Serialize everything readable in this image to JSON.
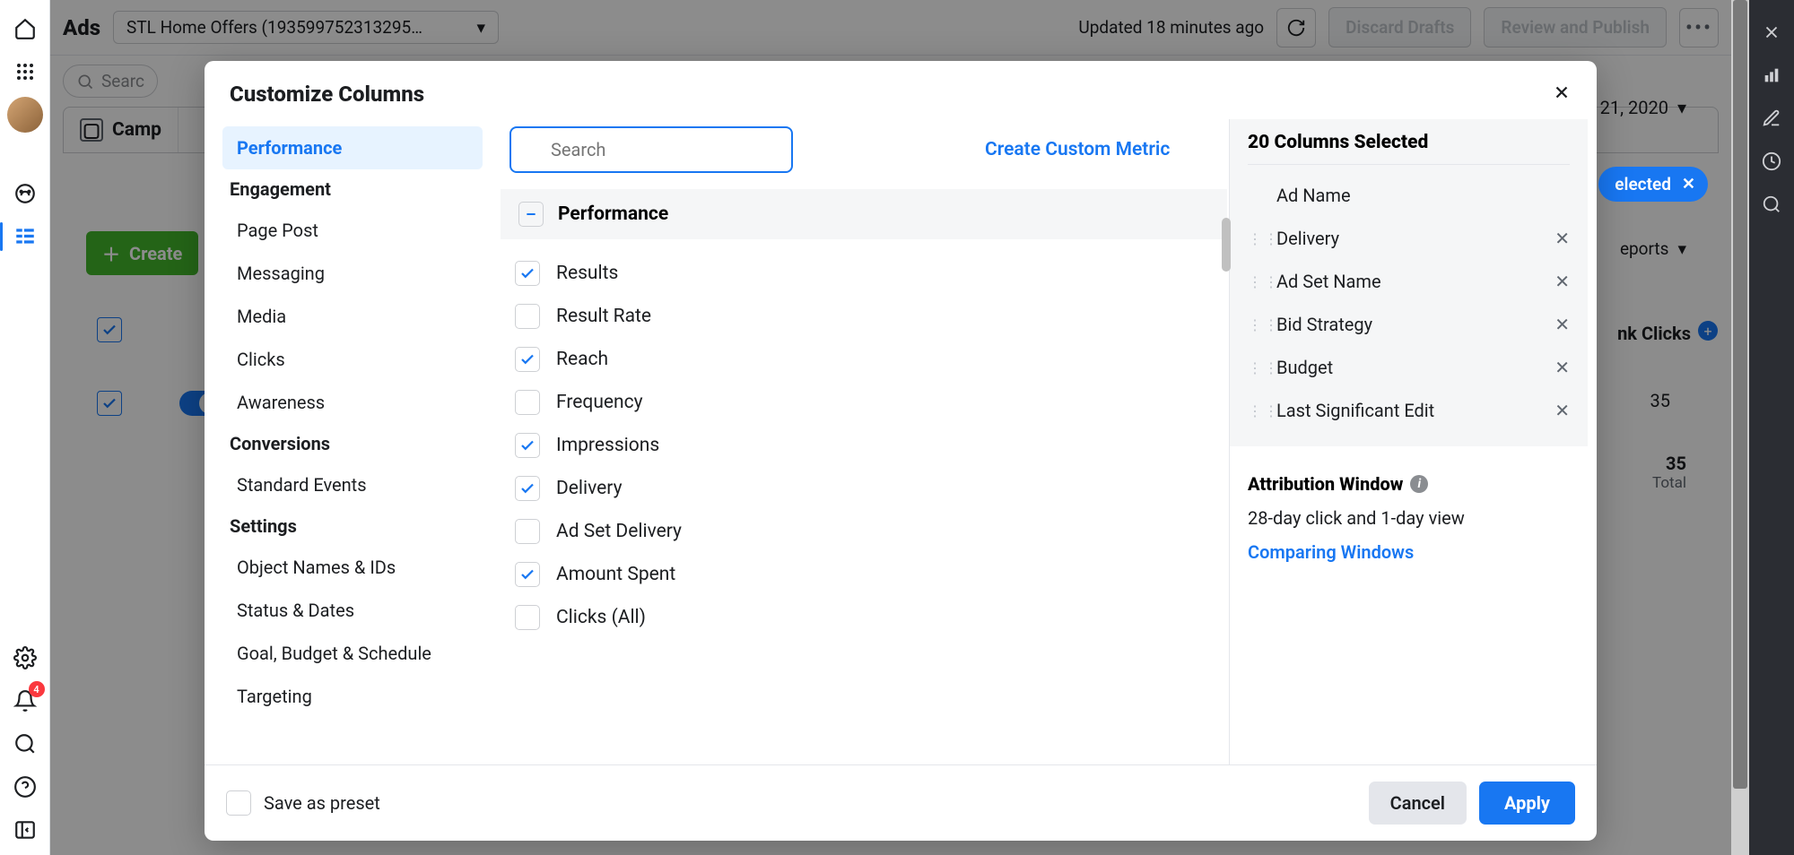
{
  "header": {
    "page_title": "Ads",
    "account_dropdown": "STL Home Offers (193599752313295…",
    "updated_text": "Updated 18 minutes ago",
    "discard_btn": "Discard Drafts",
    "publish_btn": "Review and Publish"
  },
  "search_placeholder": "Searc",
  "date_label": "21, 2020",
  "tabs": {
    "campaigns": "Camp"
  },
  "selected_pill": "elected",
  "reports_label": "eports",
  "bell_badge": "4",
  "table": {
    "col_link_clicks": "nk Clicks",
    "val_35": "35",
    "total_35": "35",
    "total_label": "Total"
  },
  "create_btn": "Create",
  "modal": {
    "title": "Customize Columns",
    "search_placeholder": "Search",
    "create_metric": "Create Custom Metric",
    "categories": [
      {
        "label": "Performance",
        "type": "item",
        "active": true
      },
      {
        "label": "Engagement",
        "type": "group"
      },
      {
        "label": "Page Post",
        "type": "item"
      },
      {
        "label": "Messaging",
        "type": "item"
      },
      {
        "label": "Media",
        "type": "item"
      },
      {
        "label": "Clicks",
        "type": "item"
      },
      {
        "label": "Awareness",
        "type": "item"
      },
      {
        "label": "Conversions",
        "type": "group"
      },
      {
        "label": "Standard Events",
        "type": "item"
      },
      {
        "label": "Settings",
        "type": "group"
      },
      {
        "label": "Object Names & IDs",
        "type": "item"
      },
      {
        "label": "Status & Dates",
        "type": "item"
      },
      {
        "label": "Goal, Budget & Schedule",
        "type": "item"
      },
      {
        "label": "Targeting",
        "type": "item"
      }
    ],
    "section_label": "Performance",
    "metrics": [
      {
        "label": "Results",
        "checked": true
      },
      {
        "label": "Result Rate",
        "checked": false
      },
      {
        "label": "Reach",
        "checked": true
      },
      {
        "label": "Frequency",
        "checked": false
      },
      {
        "label": "Impressions",
        "checked": true
      },
      {
        "label": "Delivery",
        "checked": true
      },
      {
        "label": "Ad Set Delivery",
        "checked": false
      },
      {
        "label": "Amount Spent",
        "checked": true
      },
      {
        "label": "Clicks (All)",
        "checked": false
      }
    ],
    "selected_header": "20 Columns Selected",
    "selected_items": [
      {
        "label": "Ad Name",
        "locked": true
      },
      {
        "label": "Delivery",
        "locked": false
      },
      {
        "label": "Ad Set Name",
        "locked": false
      },
      {
        "label": "Bid Strategy",
        "locked": false
      },
      {
        "label": "Budget",
        "locked": false
      },
      {
        "label": "Last Significant Edit",
        "locked": false
      }
    ],
    "attribution_header": "Attribution Window",
    "attribution_value": "28-day click and 1-day view",
    "comparing_link": "Comparing Windows",
    "save_preset": "Save as preset",
    "cancel": "Cancel",
    "apply": "Apply"
  }
}
